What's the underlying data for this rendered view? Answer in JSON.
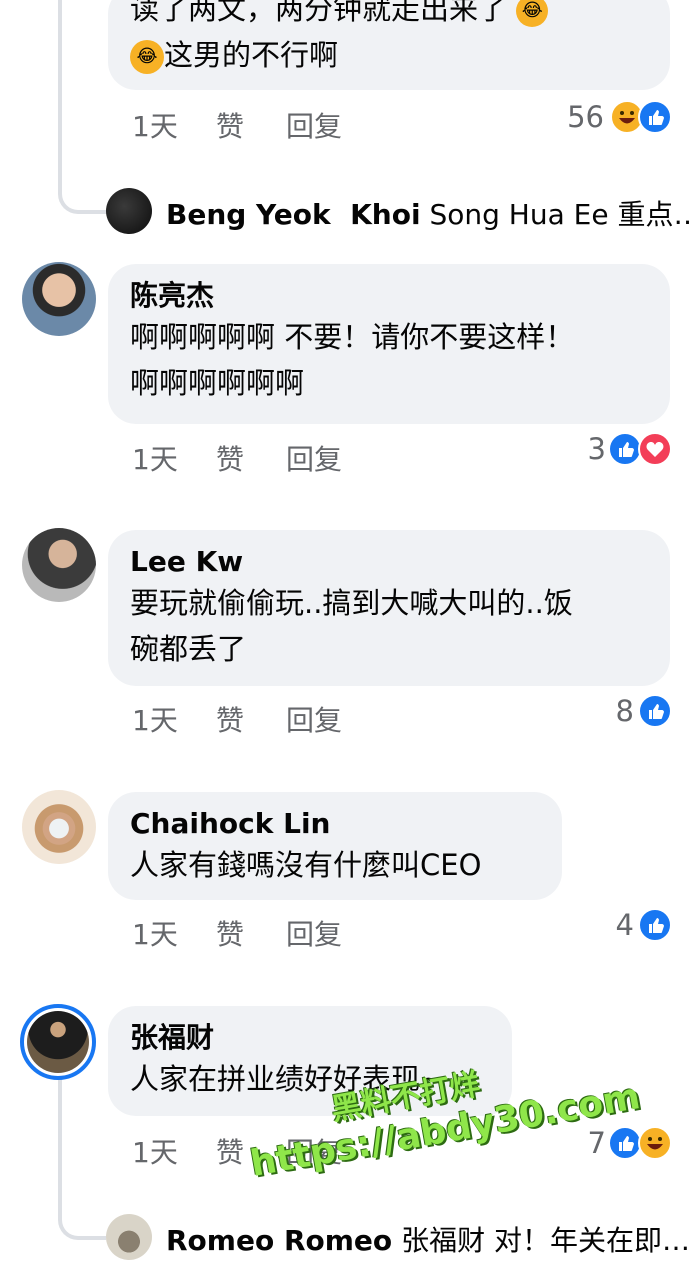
{
  "comments": [
    {
      "id": "c0",
      "text_lines": [
        "读了两文，两分钟就走出来了",
        "这男的不行啊"
      ],
      "actions": {
        "time": "1天",
        "like": "赞",
        "reply": "回复"
      },
      "reaction_count": "56",
      "reactions": [
        "haha-icon",
        "like-icon"
      ],
      "reply_preview": {
        "author": "Beng Yeok  Khoi",
        "text": "Song Hua Ee 重点…"
      }
    },
    {
      "id": "c1",
      "author": "陈亮杰",
      "text_lines": [
        "啊啊啊啊啊 不要！请你不要这样！",
        "啊啊啊啊啊啊"
      ],
      "actions": {
        "time": "1天",
        "like": "赞",
        "reply": "回复"
      },
      "reaction_count": "3",
      "reactions": [
        "like-icon",
        "love-icon"
      ]
    },
    {
      "id": "c2",
      "author": "Lee Kw",
      "text_lines": [
        "要玩就偷偷玩..搞到大喊大叫的..饭",
        "碗都丢了"
      ],
      "actions": {
        "time": "1天",
        "like": "赞",
        "reply": "回复"
      },
      "reaction_count": "8",
      "reactions": [
        "like-icon"
      ]
    },
    {
      "id": "c3",
      "author": "Chaihock Lin",
      "text_lines": [
        "人家有錢嗎沒有什麼叫CEO"
      ],
      "actions": {
        "time": "1天",
        "like": "赞",
        "reply": "回复"
      },
      "reaction_count": "4",
      "reactions": [
        "like-icon"
      ]
    },
    {
      "id": "c4",
      "author": "张福财",
      "text_lines": [
        "人家在拼业绩好好表现~"
      ],
      "actions": {
        "time": "1天",
        "like": "赞",
        "reply": "回复"
      },
      "reaction_count": "7",
      "reactions": [
        "like-icon",
        "haha-icon"
      ],
      "reply_preview": {
        "author": "Romeo Romeo",
        "text": "张福财 对！年关在即…"
      }
    }
  ],
  "watermark": {
    "line1": "黑料不打烊",
    "line2": "https://abdy30.com"
  },
  "colors": {
    "like": "#1877f2",
    "love": "#f33e58",
    "haha": "#f7b125",
    "bubble": "#f0f2f5",
    "meta": "#65676b"
  }
}
